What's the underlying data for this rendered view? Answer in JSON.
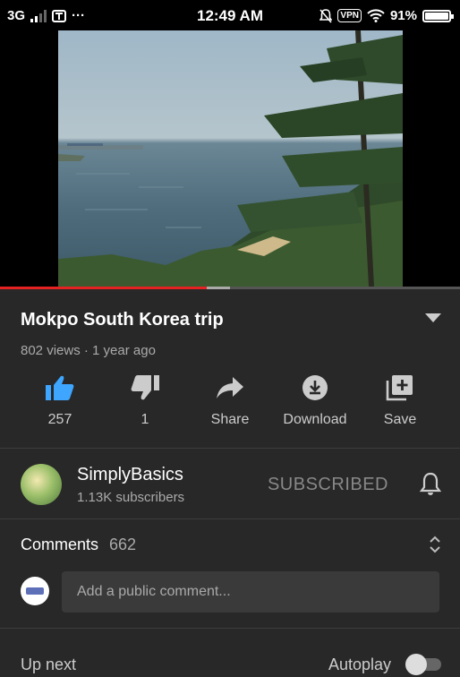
{
  "status_bar": {
    "network": "3G",
    "time": "12:49 AM",
    "vpn_label": "VPN",
    "battery": "91%"
  },
  "video": {
    "progress_fraction": 0.45,
    "buffer_fraction": 0.05
  },
  "info": {
    "title": "Mokpo South Korea trip",
    "meta": "802 views · 1 year ago"
  },
  "actions": [
    {
      "icon": "thumbs-up-icon",
      "label": "257"
    },
    {
      "icon": "thumbs-down-icon",
      "label": "1"
    },
    {
      "icon": "share-icon",
      "label": "Share"
    },
    {
      "icon": "download-icon",
      "label": "Download"
    },
    {
      "icon": "save-playlist-icon",
      "label": "Save"
    }
  ],
  "channel": {
    "name": "SimplyBasics",
    "subscribers": "1.13K subscribers",
    "subscribe_label": "SUBSCRIBED"
  },
  "comments": {
    "label": "Comments",
    "count": "662",
    "placeholder": "Add a public comment..."
  },
  "up_next": {
    "label": "Up next",
    "autoplay_label": "Autoplay",
    "autoplay_on": false
  },
  "colors": {
    "background": "#282828",
    "like_accent": "#3ea6ff",
    "progress": "#e52222"
  }
}
